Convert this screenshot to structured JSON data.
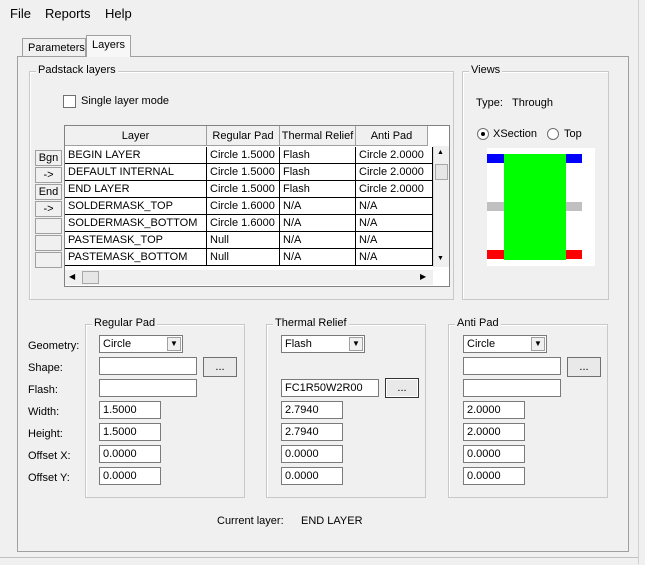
{
  "menu": {
    "file": "File",
    "reports": "Reports",
    "help": "Help"
  },
  "tabs": {
    "parameters": "Parameters",
    "layers": "Layers"
  },
  "padstack": {
    "title": "Padstack layers",
    "single_layer_mode": "Single layer mode",
    "single_layer_checked": false,
    "columns": [
      "Layer",
      "Regular Pad",
      "Thermal Relief",
      "Anti Pad"
    ],
    "rows": [
      {
        "btn": "Bgn",
        "layer": "BEGIN LAYER",
        "regular": "Circle 1.5000",
        "thermal": "Flash",
        "anti": "Circle 2.0000"
      },
      {
        "btn": "->",
        "layer": "DEFAULT INTERNAL",
        "regular": "Circle 1.5000",
        "thermal": "Flash",
        "anti": "Circle 2.0000"
      },
      {
        "btn": "End",
        "layer": "END LAYER",
        "regular": "Circle 1.5000",
        "thermal": "Flash",
        "anti": "Circle 2.0000"
      },
      {
        "btn": "->",
        "layer": "SOLDERMASK_TOP",
        "regular": "Circle 1.6000",
        "thermal": "N/A",
        "anti": "N/A"
      },
      {
        "btn": "",
        "layer": "SOLDERMASK_BOTTOM",
        "regular": "Circle 1.6000",
        "thermal": "N/A",
        "anti": "N/A"
      },
      {
        "btn": "",
        "layer": "PASTEMASK_TOP",
        "regular": "Null",
        "thermal": "N/A",
        "anti": "N/A"
      },
      {
        "btn": "",
        "layer": "PASTEMASK_BOTTOM",
        "regular": "Null",
        "thermal": "N/A",
        "anti": "N/A"
      }
    ]
  },
  "views": {
    "title": "Views",
    "type_label": "Type:",
    "type_value": "Through",
    "xsection": "XSection",
    "top": "Top",
    "selected": "XSection",
    "colors": {
      "pad_top": "#0000ff",
      "pad_mid": "#c0c0c0",
      "pad_bottom": "#ff0000",
      "body": "#00ff00",
      "bg": "#ffffff"
    }
  },
  "fields": {
    "labels": [
      "Geometry:",
      "Shape:",
      "Flash:",
      "Width:",
      "Height:",
      "Offset X:",
      "Offset Y:"
    ]
  },
  "regular_pad": {
    "title": "Regular Pad",
    "geometry": "Circle",
    "shape": "",
    "flash": "",
    "width": "1.5000",
    "height": "1.5000",
    "offset_x": "0.0000",
    "offset_y": "0.0000",
    "browse": "..."
  },
  "thermal_relief": {
    "title": "Thermal Relief",
    "geometry": "Flash",
    "flash": "FC1R50W2R00",
    "width": "2.7940",
    "height": "2.7940",
    "offset_x": "0.0000",
    "offset_y": "0.0000",
    "browse": "..."
  },
  "anti_pad": {
    "title": "Anti Pad",
    "geometry": "Circle",
    "shape": "",
    "flash": "",
    "width": "2.0000",
    "height": "2.0000",
    "offset_x": "0.0000",
    "offset_y": "0.0000",
    "browse": "..."
  },
  "status": {
    "current_layer_label": "Current layer:",
    "current_layer_value": "END LAYER"
  }
}
